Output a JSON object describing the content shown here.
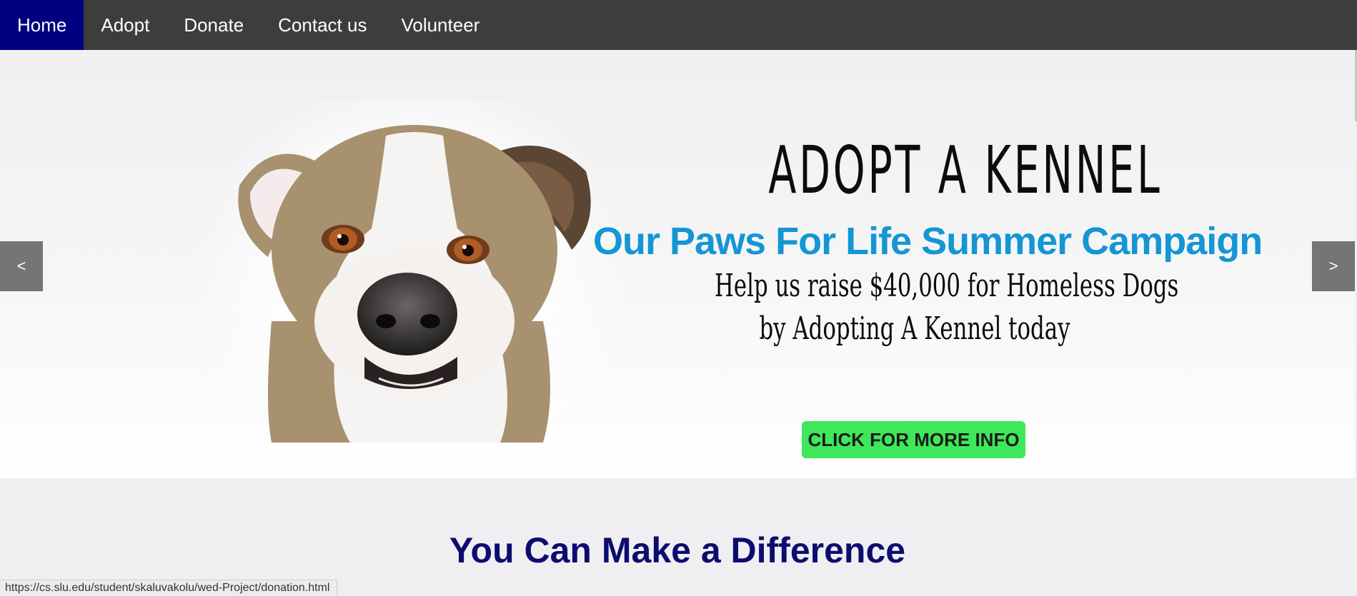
{
  "nav": {
    "items": [
      {
        "label": "Home",
        "active": true
      },
      {
        "label": "Adopt"
      },
      {
        "label": "Donate"
      },
      {
        "label": "Contact us"
      },
      {
        "label": "Volunteer"
      }
    ],
    "active_color": "#000080",
    "bg_color": "#3d3d3d"
  },
  "hero": {
    "title": "ADOPT A KENNEL",
    "subtitle": "Our Paws For Life Summer Campaign",
    "line1": "Help us raise $40,000 for Homeless Dogs",
    "line2": "by Adopting A Kennel today",
    "cta_label": "CLICK FOR MORE INFO",
    "prev_label": "<",
    "next_label": ">",
    "subtitle_color": "#1496d4",
    "cta_color": "#3ee85a"
  },
  "section": {
    "title": "You Can Make a Difference"
  },
  "status": {
    "url": "https://cs.slu.edu/student/skaluvakolu/wed-Project/donation.html"
  }
}
